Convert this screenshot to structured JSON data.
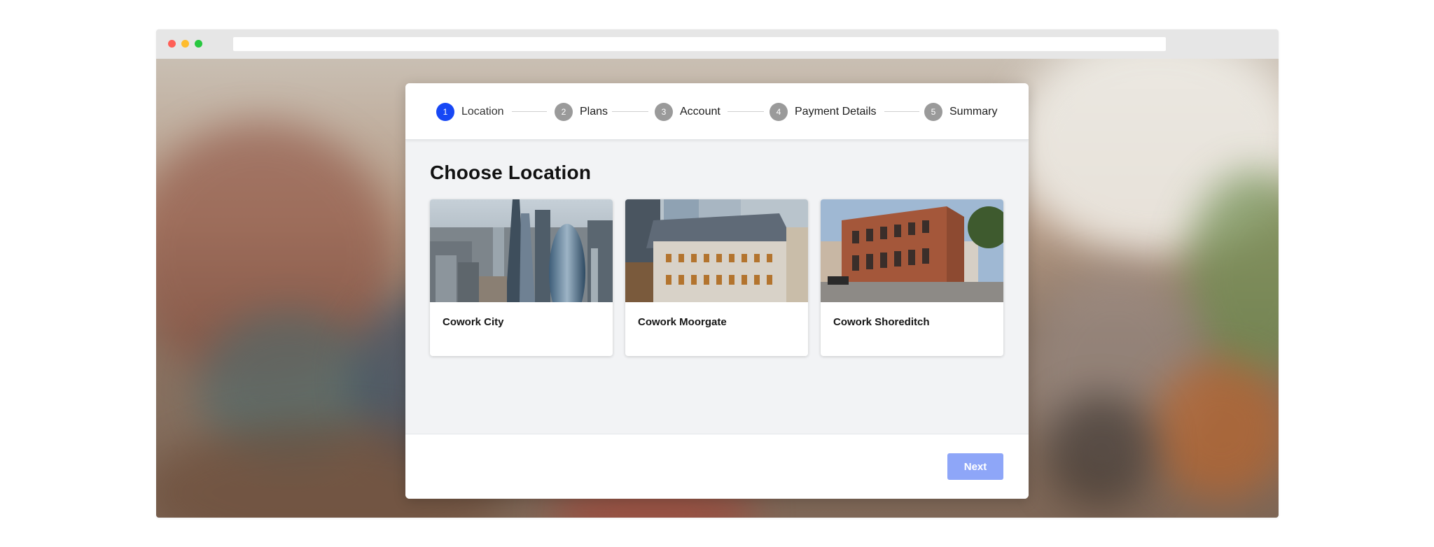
{
  "browser": {
    "window_controls": [
      "close",
      "minimize",
      "maximize"
    ],
    "address_bar": ""
  },
  "colors": {
    "accent": "#1747f5",
    "step_inactive": "#9a9a9a",
    "next_button": "#8ea6f8"
  },
  "stepper": {
    "steps": [
      {
        "number": "1",
        "label": "Location",
        "active": true
      },
      {
        "number": "2",
        "label": "Plans",
        "active": false
      },
      {
        "number": "3",
        "label": "Account",
        "active": false
      },
      {
        "number": "4",
        "label": "Payment Details",
        "active": false
      },
      {
        "number": "5",
        "label": "Summary",
        "active": false
      }
    ]
  },
  "main": {
    "title": "Choose Location",
    "locations": [
      {
        "name": "Cowork City",
        "image": "city-skyline-photo"
      },
      {
        "name": "Cowork Moorgate",
        "image": "classic-building-photo"
      },
      {
        "name": "Cowork Shoreditch",
        "image": "brick-building-photo"
      }
    ]
  },
  "footer": {
    "next_label": "Next"
  }
}
